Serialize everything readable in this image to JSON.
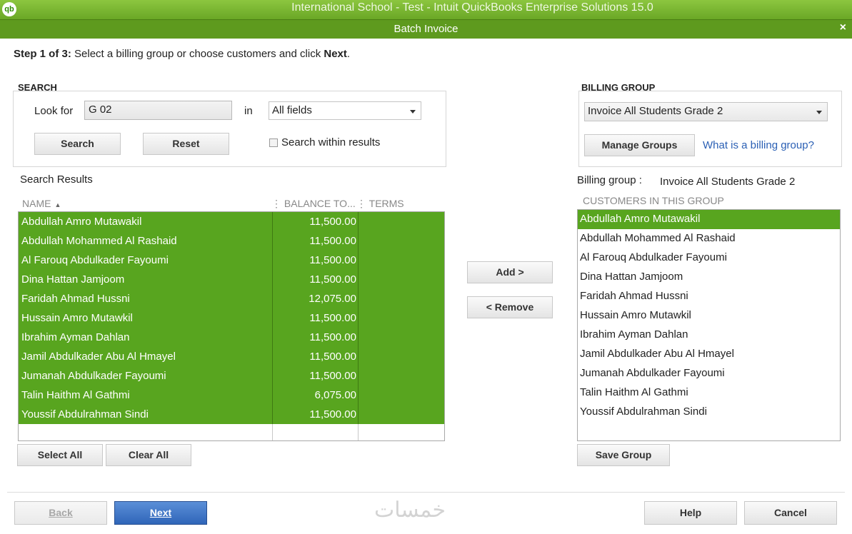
{
  "window": {
    "app_title": "International School - Test  - Intuit QuickBooks Enterprise Solutions 15.0",
    "logo_text": "qb",
    "dialog_title": "Batch Invoice",
    "close_glyph": "×"
  },
  "step": {
    "prefix": "Step 1 of 3:",
    "text": " Select a billing group or choose customers and click ",
    "bold_word": "Next",
    "suffix": "."
  },
  "search": {
    "section_label": "SEARCH",
    "look_for_label": "Look for",
    "look_for_value": "G 02",
    "in_label": "in",
    "field_selected": "All fields",
    "search_button": "Search",
    "reset_button": "Reset",
    "within_results_label": "Search within results"
  },
  "results": {
    "title": "Search Results",
    "columns": {
      "name": "NAME",
      "balance": "BALANCE TO...",
      "terms": "TERMS"
    },
    "rows": [
      {
        "name": "Abdullah Amro Mutawakil",
        "balance": "11,500.00"
      },
      {
        "name": "Abdullah Mohammed Al Rashaid",
        "balance": "11,500.00"
      },
      {
        "name": "Al Farouq Abdulkader Fayoumi",
        "balance": "11,500.00"
      },
      {
        "name": "Dina Hattan Jamjoom",
        "balance": "11,500.00"
      },
      {
        "name": "Faridah Ahmad Hussni",
        "balance": "12,075.00"
      },
      {
        "name": "Hussain Amro Mutawkil",
        "balance": "11,500.00"
      },
      {
        "name": "Ibrahim Ayman  Dahlan",
        "balance": "11,500.00"
      },
      {
        "name": "Jamil Abdulkader Abu Al Hmayel",
        "balance": "11,500.00"
      },
      {
        "name": "Jumanah Abdulkader Fayoumi",
        "balance": "11,500.00"
      },
      {
        "name": "Talin Haithm Al Gathmi",
        "balance": "6,075.00"
      },
      {
        "name": "Youssif Abdulrahman Sindi",
        "balance": "11,500.00"
      }
    ],
    "select_all_button": "Select All",
    "clear_all_button": "Clear All"
  },
  "transfer": {
    "add_button": "Add >",
    "remove_button": "< Remove"
  },
  "billing_group": {
    "section_label": "BILLING GROUP",
    "selected": "Invoice All Students Grade 2",
    "manage_button": "Manage Groups",
    "help_link": "What is a billing group?",
    "label": "Billing group :",
    "value": "Invoice All Students Grade 2",
    "customers_header": "CUSTOMERS IN THIS GROUP",
    "customers": [
      "Abdullah Amro Mutawakil",
      "Abdullah Mohammed Al Rashaid",
      "Al Farouq Abdulkader Fayoumi",
      "Dina Hattan Jamjoom",
      "Faridah Ahmad Hussni",
      "Hussain Amro Mutawkil",
      "Ibrahim Ayman  Dahlan",
      "Jamil Abdulkader Abu Al Hmayel",
      "Jumanah Abdulkader Fayoumi",
      "Talin Haithm Al Gathmi",
      "Youssif Abdulrahman Sindi"
    ],
    "save_button": "Save Group"
  },
  "footer": {
    "back_button": "Back",
    "next_button": "Next",
    "help_button": "Help",
    "cancel_button": "Cancel",
    "watermark": "خمسات"
  },
  "colors": {
    "accent_green": "#58a51f",
    "title_green": "#6aa726",
    "primary_blue": "#2f65b8",
    "link_blue": "#2a5fb4"
  }
}
